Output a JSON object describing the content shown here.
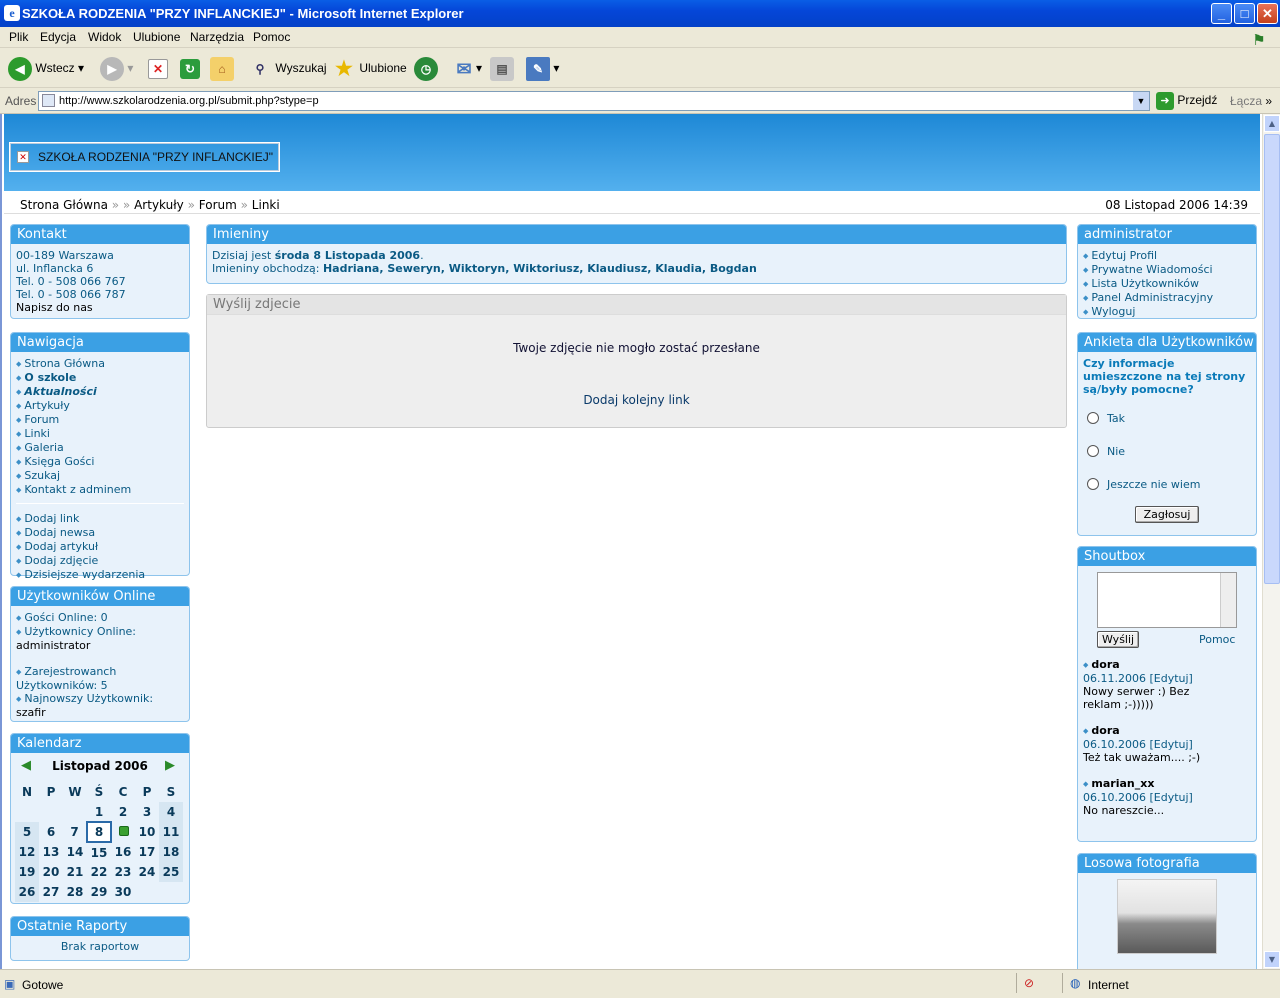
{
  "window": {
    "title": "SZKOŁA RODZENIA \"PRZY INFLANCKIEJ\" - Microsoft Internet Explorer",
    "min": "_",
    "max": "□",
    "close": "✕"
  },
  "menu": [
    "Plik",
    "Edycja",
    "Widok",
    "Ulubione",
    "Narzędzia",
    "Pomoc"
  ],
  "toolbar": {
    "back": "Wstecz",
    "search": "Wyszukaj",
    "favorites": "Ulubione"
  },
  "address": {
    "label": "Adres",
    "url": "http://www.szkolarodzenia.org.pl/submit.php?stype=p",
    "go": "Przejdź",
    "links": "Łącza"
  },
  "status": {
    "text": "Gotowe",
    "zone": "Internet"
  },
  "site": {
    "logo_alt": "SZKOŁA RODZENIA \"PRZY INFLANCKIEJ\""
  },
  "breadcrumb": {
    "home": "Strona Główna",
    "items": [
      "Artykuły",
      "Forum",
      "Linki"
    ],
    "datetime": "08 Listopad 2006 14:39"
  },
  "kontakt": {
    "title": "Kontakt",
    "lines": [
      "00-189 Warszawa",
      "ul. Inflancka 6",
      "Tel. 0 - 508 066 767",
      "Tel. 0 - 508 066 787"
    ],
    "mail": "Napisz do nas"
  },
  "nav": {
    "title": "Nawigacja",
    "items": [
      "Strona Główna",
      "O szkole",
      "Aktualności",
      "Artykuły",
      "Forum",
      "Linki",
      "Galeria",
      "Księga Gości",
      "Szukaj",
      "Kontakt z adminem"
    ],
    "items2": [
      "Dodaj link",
      "Dodaj newsa",
      "Dodaj artykuł",
      "Dodaj zdjęcie",
      "Dzisiejsze wydarzenia"
    ]
  },
  "online": {
    "title": "Użytkowników Online",
    "guests": "Gości Online: 0",
    "users_label": "Użytkownicy Online:",
    "users": "administrator",
    "registered_a": "Zarejestrowanch",
    "registered_b": "Użytkowników: 5",
    "newest_label": "Najnowszy Użytkownik:",
    "newest": "szafir"
  },
  "calendar": {
    "title": "Kalendarz",
    "month": "Listopad 2006",
    "days": [
      "N",
      "P",
      "W",
      "Ś",
      "C",
      "P",
      "S"
    ],
    "weeks": [
      [
        "",
        "",
        "",
        "1",
        "2",
        "3",
        "4"
      ],
      [
        "5",
        "6",
        "7",
        "8",
        "•",
        "10",
        "11"
      ],
      [
        "12",
        "13",
        "14",
        "15",
        "16",
        "17",
        "18"
      ],
      [
        "19",
        "20",
        "21",
        "22",
        "23",
        "24",
        "25"
      ],
      [
        "26",
        "27",
        "28",
        "29",
        "30",
        "",
        ""
      ]
    ]
  },
  "raporty": {
    "title": "Ostatnie Raporty",
    "text": "Brak raportow"
  },
  "imieniny": {
    "title": "Imieniny",
    "prefix": "Dzisiaj jest ",
    "date": "środa 8 Listopada 2006",
    "dot": ".",
    "names_label": "Imieniny obchodzą: ",
    "names": "Hadriana, Seweryn, Wiktoryn, Wiktoriusz, Klaudiusz, Klaudia, Bogdan"
  },
  "upload": {
    "title": "Wyślij zdjecie",
    "message": "Twoje zdjęcie nie mogło zostać przesłane",
    "link": "Dodaj kolejny link"
  },
  "admin": {
    "title": "administrator",
    "items": [
      "Edytuj Profil",
      "Prywatne Wiadomości",
      "Lista Użytkowników",
      "Panel Administracyjny",
      "Wyloguj"
    ]
  },
  "poll": {
    "title": "Ankieta dla Użytkowników",
    "question": "Czy informacje umieszczone na tej strony są/były pomocne?",
    "options": [
      "Tak",
      "Nie",
      "Jeszcze nie wiem"
    ],
    "vote": "Zagłosuj"
  },
  "shoutbox": {
    "title": "Shoutbox",
    "send": "Wyślij",
    "help": "Pomoc",
    "posts": [
      {
        "author": "dora",
        "date": "06.11.2006",
        "edit": "[Edytuj]",
        "text": "Nowy serwer :) Bez reklam ;-)))))"
      },
      {
        "author": "dora",
        "date": "06.10.2006",
        "edit": "[Edytuj]",
        "text": "Też tak uważam.... ;-)"
      },
      {
        "author": "marian_xx",
        "date": "06.10.2006",
        "edit": "[Edytuj]",
        "text": "No nareszcie..."
      }
    ]
  },
  "photo": {
    "title": "Losowa fotografia"
  }
}
